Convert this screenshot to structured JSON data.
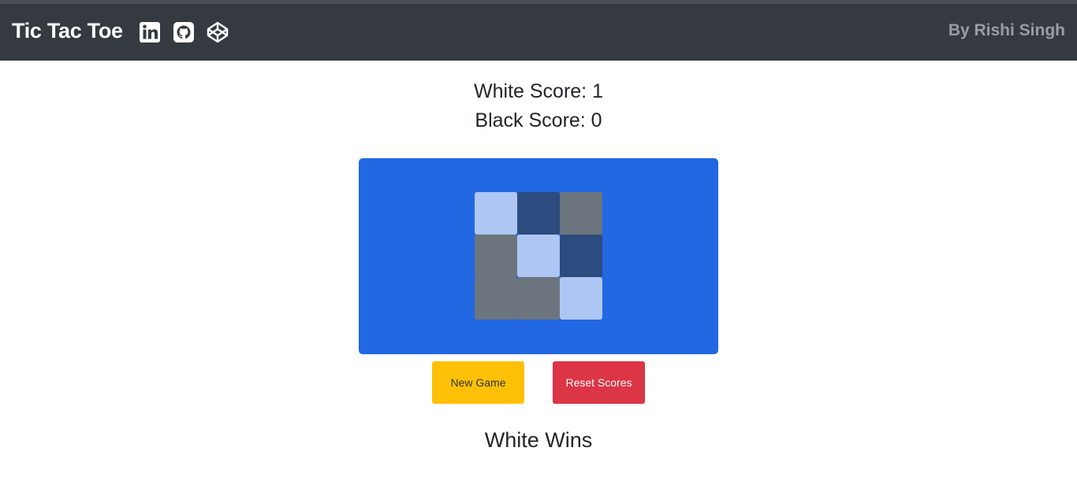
{
  "navbar": {
    "brand": "Tic Tac Toe",
    "icons": [
      "linkedin-icon",
      "github-icon",
      "codepen-icon"
    ],
    "byline": "By Rishi Singh",
    "background": "#343a40"
  },
  "scores": {
    "white": "White Score: 1",
    "black": "Black Score: 0"
  },
  "board": {
    "background": "#2268e2",
    "cells": [
      [
        "white",
        "black",
        "empty"
      ],
      [
        "empty",
        "white",
        "black"
      ],
      [
        "empty",
        "empty",
        "white"
      ]
    ],
    "colors": {
      "white": "#aec6f4",
      "black": "#2c4b7e",
      "empty": "#6c757d"
    }
  },
  "buttons": {
    "new_game": "New Game",
    "reset_scores": "Reset Scores"
  },
  "status": "White Wins"
}
